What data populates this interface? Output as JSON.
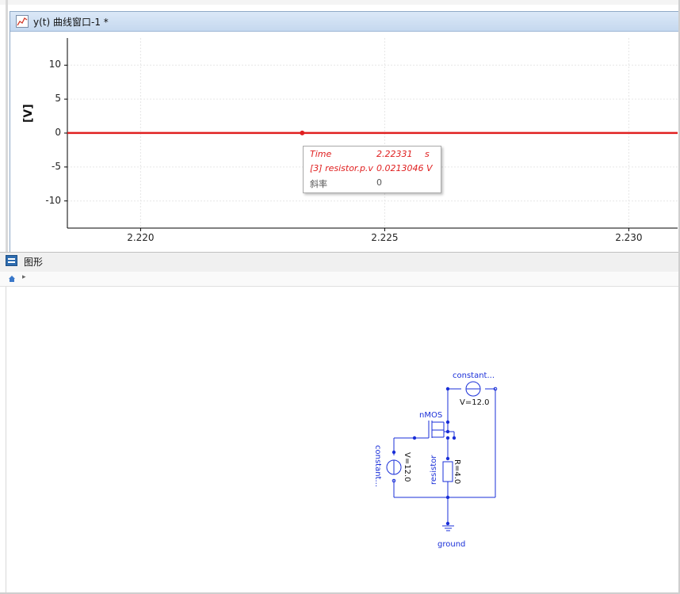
{
  "plot_window": {
    "title": "y(t) 曲线窗口-1 *",
    "y_axis_label": "[V]",
    "y_ticks": [
      "10",
      "5",
      "0",
      "-5",
      "-10"
    ],
    "x_ticks": [
      "2.220",
      "2.225",
      "2.230"
    ],
    "series_color": "#e02020",
    "grid": true
  },
  "chart_data": {
    "type": "line",
    "ylabel": "[V]",
    "xlim": [
      2.2185,
      2.231
    ],
    "ylim": [
      -14,
      14
    ],
    "series": [
      {
        "name": "[3] resistor.p.v",
        "x": [
          2.2185,
          2.231
        ],
        "y": [
          0.0213046,
          0.0213046
        ]
      }
    ],
    "tooltip_point": {
      "x": 2.22331,
      "y": 0.0213046
    }
  },
  "tooltip": {
    "row1_label": "Time",
    "row1_value": "2.22331",
    "row1_unit": "s",
    "row2_label": "[3] resistor.p.v",
    "row2_value": "0.0213046",
    "row2_unit": "V",
    "row3_label": "斜率",
    "row3_value": "0"
  },
  "graph_panel": {
    "title": "图形"
  },
  "diagram": {
    "constant_top_label": "constant...",
    "constant_top_param": "V=12.0",
    "nmos_label": "nMOS",
    "constant_left_label": "constant...",
    "constant_left_param": "V=12.0",
    "resistor_label": "resistor",
    "resistor_param": "R=4.0",
    "ground_label": "ground",
    "wire_color": "#1a2fd8"
  }
}
